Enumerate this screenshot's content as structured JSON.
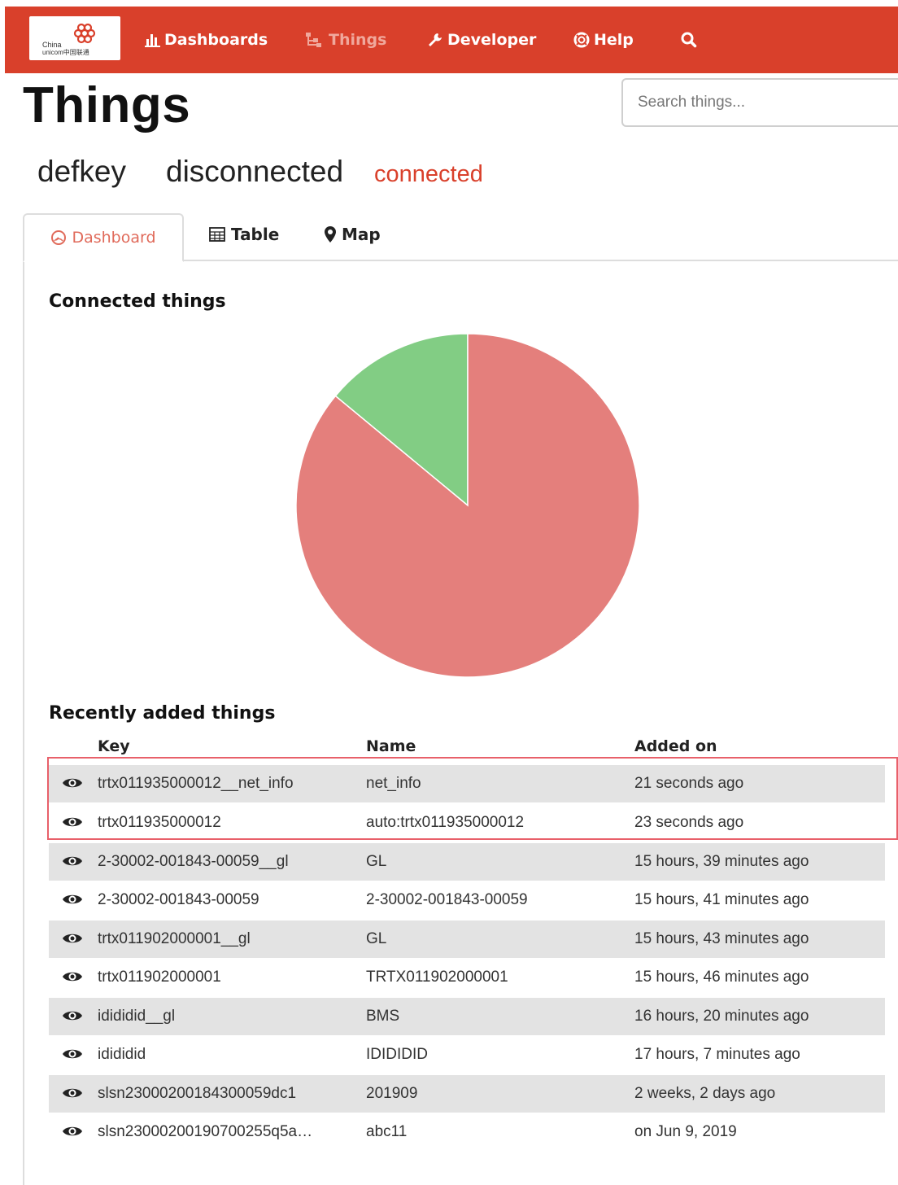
{
  "nav": {
    "logo": {
      "brand_line1": "China",
      "brand_line2": "unicom中国联通"
    },
    "items": [
      {
        "label": "Dashboards",
        "icon": "bar-chart-icon"
      },
      {
        "label": "Things",
        "icon": "sitemap-icon"
      },
      {
        "label": "Developer",
        "icon": "wrench-icon"
      },
      {
        "label": "Help",
        "icon": "life-ring-icon"
      }
    ],
    "search_icon": "search-icon"
  },
  "page": {
    "title": "Things",
    "search_placeholder": "Search things..."
  },
  "status_filters": {
    "defkey": "defkey",
    "disconnected": "disconnected",
    "connected": "connected"
  },
  "tabs": [
    {
      "label": "Dashboard",
      "icon": "dashboard-icon",
      "active": true
    },
    {
      "label": "Table",
      "icon": "table-icon",
      "active": false
    },
    {
      "label": "Map",
      "icon": "map-marker-icon",
      "active": false
    }
  ],
  "dashboard": {
    "connected_title": "Connected things",
    "recent_title": "Recently added things"
  },
  "chart_data": {
    "type": "pie",
    "title": "Connected things",
    "slices": [
      {
        "label": "connected",
        "value": 14,
        "color": "#82cd84"
      },
      {
        "label": "disconnected",
        "value": 86,
        "color": "#e47f7c"
      }
    ]
  },
  "recent_table": {
    "columns": [
      "Key",
      "Name",
      "Added on"
    ],
    "highlight_rows": [
      0,
      1
    ],
    "highlight_color": "#e8606a",
    "rows": [
      {
        "key": "trtx011935000012__net_info",
        "name": "net_info",
        "added": "21 seconds ago"
      },
      {
        "key": "trtx011935000012",
        "name": "auto:trtx011935000012",
        "added": "23 seconds ago"
      },
      {
        "key": "2-30002-001843-00059__gl",
        "name": "GL",
        "added": "15 hours, 39 minutes ago"
      },
      {
        "key": "2-30002-001843-00059",
        "name": "2-30002-001843-00059",
        "added": "15 hours, 41 minutes ago"
      },
      {
        "key": "trtx011902000001__gl",
        "name": "GL",
        "added": "15 hours, 43 minutes ago"
      },
      {
        "key": "trtx011902000001",
        "name": "TRTX011902000001",
        "added": "15 hours, 46 minutes ago"
      },
      {
        "key": "idididid__gl",
        "name": "BMS",
        "added": "16 hours, 20 minutes ago"
      },
      {
        "key": "idididid",
        "name": "IDIDIDID",
        "added": "17 hours, 7 minutes ago"
      },
      {
        "key": "slsn23000200184300059dc1",
        "name": "201909",
        "added": "2 weeks, 2 days ago"
      },
      {
        "key": "slsn23000200190700255q5a…",
        "name": "abc11",
        "added": "on Jun 9, 2019"
      }
    ]
  },
  "colors": {
    "brand": "#d9402b",
    "row_stripe": "#e3e3e3",
    "active_tab_text": "#e06a5a"
  }
}
